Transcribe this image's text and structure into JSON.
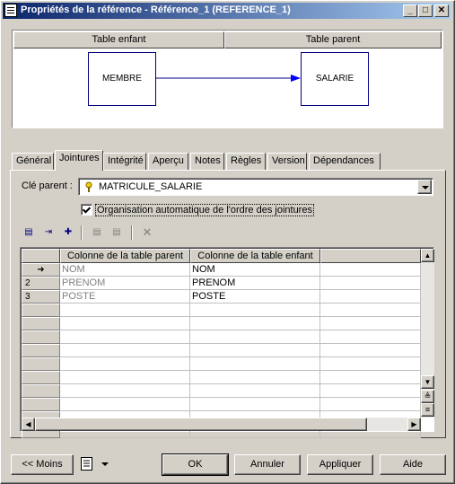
{
  "window": {
    "title": "Propriétés de la référence - Référence_1 (REFERENCE_1)",
    "minimize": "_",
    "maximize": "□",
    "close": "✕"
  },
  "diagram": {
    "child_header": "Table enfant",
    "parent_header": "Table parent",
    "child_entity": "MEMBRE",
    "parent_entity": "SALARIE"
  },
  "tabs": [
    "Général",
    "Jointures",
    "Intégrité",
    "Aperçu",
    "Notes",
    "Règles",
    "Version",
    "Dépendances"
  ],
  "active_tab": "Jointures",
  "form": {
    "parent_key_label": "Clé parent :",
    "parent_key_value": "MATRICULE_SALARIE",
    "auto_order_label": "Organisation automatique de l'ordre des jointures",
    "auto_order_checked": true
  },
  "toolbar": {
    "icons": [
      "properties-icon",
      "insert-join-icon",
      "add-join-icon",
      "move-up-icon",
      "move-down-icon",
      "delete-icon"
    ]
  },
  "grid": {
    "columns": [
      "Colonne de la table parent",
      "Colonne de la table enfant"
    ],
    "rows": [
      {
        "marker": "➜",
        "parent": "NOM",
        "child": "NOM"
      },
      {
        "marker": "2",
        "parent": "PRENOM",
        "child": "PRENOM"
      },
      {
        "marker": "3",
        "parent": "POSTE",
        "child": "POSTE"
      }
    ],
    "empty_rows": 10
  },
  "buttons": {
    "less": "<< Moins",
    "ok": "OK",
    "cancel": "Annuler",
    "apply": "Appliquer",
    "help": "Aide"
  }
}
